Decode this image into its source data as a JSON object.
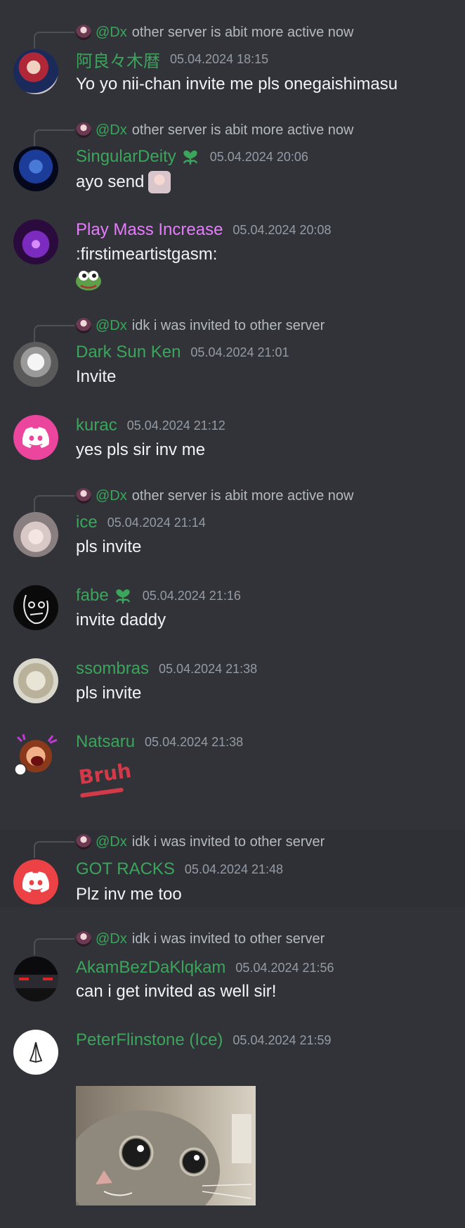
{
  "messages": [
    {
      "reply": {
        "mention": "@Dx",
        "text": "other server is abit more active now"
      },
      "username": "阿良々木暦",
      "timestamp": "05.04.2024 18:15",
      "text": "Yo yo nii-chan invite me pls onegaishimasu",
      "avatar": "anime-avatar"
    },
    {
      "reply": {
        "mention": "@Dx",
        "text": "other server is abit more active now"
      },
      "username": "SingularDeity",
      "timestamp": "05.04.2024 20:06",
      "text": "ayo send",
      "avatar": "blue-face-avatar",
      "badge": "heart-sprout-icon"
    },
    {
      "username": "Play Mass Increase",
      "timestamp": "05.04.2024 20:08",
      "text": ":firstimeartistgasm:",
      "avatar": "purple-hand-avatar"
    },
    {
      "reply": {
        "mention": "@Dx",
        "text": "idk i was invited to other server"
      },
      "username": "Dark Sun Ken",
      "timestamp": "05.04.2024 21:01",
      "text": "Invite",
      "avatar": "manga-avatar"
    },
    {
      "username": "kurac",
      "timestamp": "05.04.2024 21:12",
      "text": "yes pls sir inv me",
      "avatar": "discord-logo-avatar"
    },
    {
      "reply": {
        "mention": "@Dx",
        "text": "other server is abit more active now"
      },
      "username": "ice",
      "timestamp": "05.04.2024 21:14",
      "text": "pls invite",
      "avatar": "bunny-girl-avatar"
    },
    {
      "username": "fabe",
      "timestamp": "05.04.2024 21:16",
      "text": "invite daddy",
      "avatar": "doodle-avatar",
      "badge": "heart-sprout-icon"
    },
    {
      "username": "ssombras",
      "timestamp": "05.04.2024 21:38",
      "text": "pls invite",
      "avatar": "bird-avatar"
    },
    {
      "username": "Natsaru",
      "timestamp": "05.04.2024 21:38",
      "sticker_text": "Bruh",
      "avatar": "angry-anime-avatar"
    },
    {
      "reply": {
        "mention": "@Dx",
        "text": "idk i was invited to other server"
      },
      "username": "GOT RACKS",
      "timestamp": "05.04.2024 21:48",
      "text": "Plz inv me too",
      "avatar": "discord-logo-avatar"
    },
    {
      "reply": {
        "mention": "@Dx",
        "text": "idk i was invited to other server"
      },
      "username": "AkamBezDaKlqkam",
      "timestamp": "05.04.2024 21:56",
      "text": "can i get invited as well sir!",
      "avatar": "car-avatar"
    },
    {
      "username": "PeterFlinstone (Ice)",
      "timestamp": "05.04.2024 21:59",
      "avatar": "praying-hands-avatar",
      "attachment": "cat-gif"
    }
  ]
}
